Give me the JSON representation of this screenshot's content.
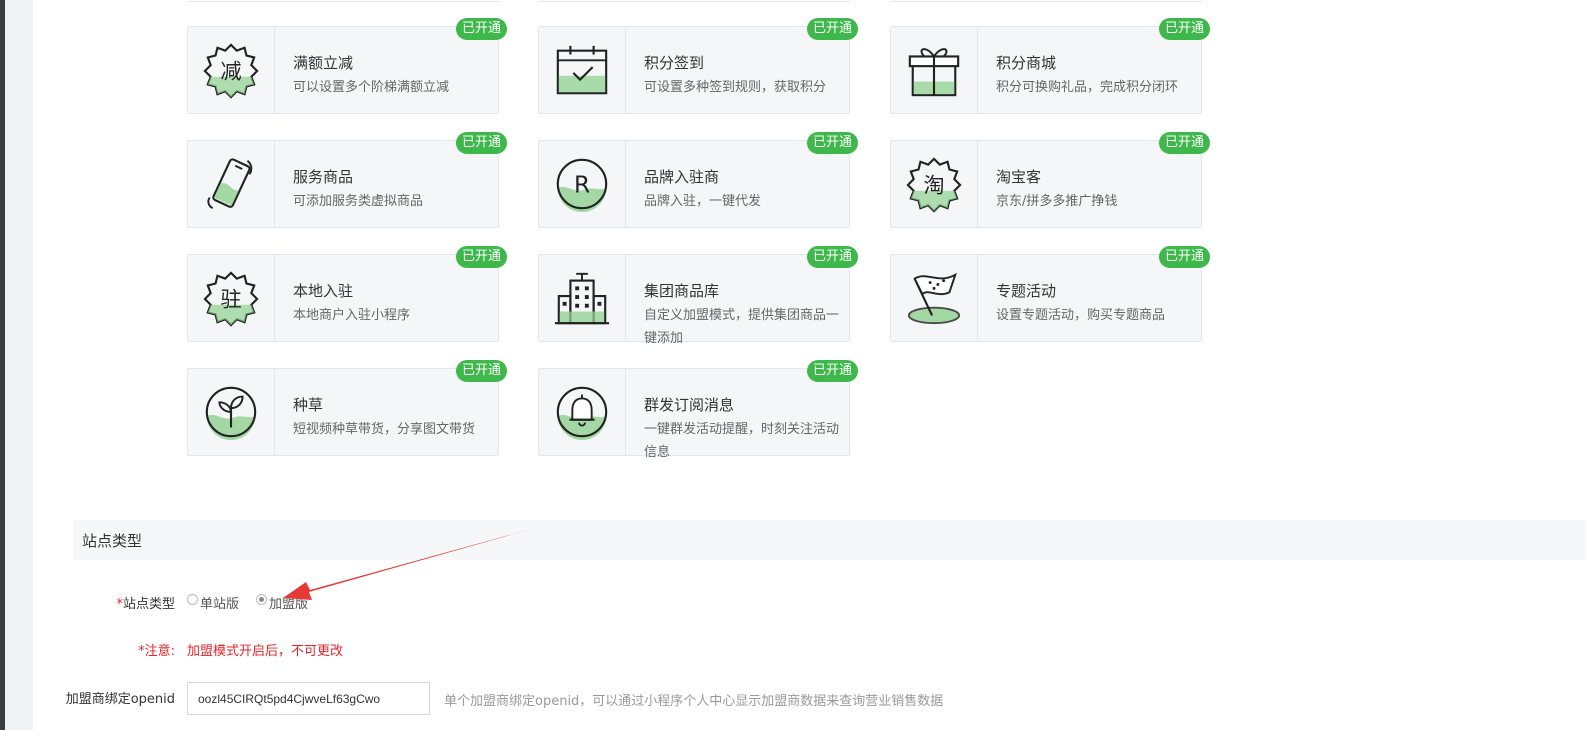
{
  "badge_label": "已开通",
  "colors": {
    "accent_green": "#3eb84a",
    "required_red": "#e0262a",
    "annotation_arrow": "#e53935"
  },
  "cards": [
    {
      "title": "满额立减",
      "desc": "可以设置多个阶梯满额立减",
      "icon": "discount-icon"
    },
    {
      "title": "积分签到",
      "desc": "可设置多种签到规则，获取积分",
      "icon": "calendar-check-icon"
    },
    {
      "title": "积分商城",
      "desc": "积分可换购礼品，完成积分闭环",
      "icon": "gift-icon"
    },
    {
      "title": "服务商品",
      "desc": "可添加服务类虚拟商品",
      "icon": "phone-icon"
    },
    {
      "title": "品牌入驻商",
      "desc": "品牌入驻，一键代发",
      "icon": "brand-r-icon"
    },
    {
      "title": "淘宝客",
      "desc": "京东/拼多多推广挣钱",
      "icon": "taobao-icon"
    },
    {
      "title": "本地入驻",
      "desc": "本地商户入驻小程序",
      "icon": "local-icon"
    },
    {
      "title": "集团商品库",
      "desc": "自定义加盟模式，提供集团商品一键添加",
      "icon": "building-icon"
    },
    {
      "title": "专题活动",
      "desc": "设置专题活动，购买专题商品",
      "icon": "flag-icon"
    },
    {
      "title": "种草",
      "desc": "短视频种草带货，分享图文带货",
      "icon": "sprout-icon"
    },
    {
      "title": "群发订阅消息",
      "desc": "一键群发活动提醒，时刻关注活动信息",
      "icon": "bell-icon"
    }
  ],
  "section": {
    "title": "站点类型"
  },
  "form": {
    "required_mark": "*",
    "site_type_label": "站点类型",
    "options": [
      {
        "label": "单站版",
        "checked": false
      },
      {
        "label": "加盟版",
        "checked": true
      }
    ],
    "note_label": "注意:",
    "note_text": "加盟模式开启后，不可更改",
    "openid_label": "加盟商绑定openid",
    "openid_value": "oozl45CIRQt5pd4CjwveLf63gCwo",
    "openid_hint": "单个加盟商绑定openid，可以通过小程序个人中心显示加盟商数据来查询营业销售数据"
  }
}
